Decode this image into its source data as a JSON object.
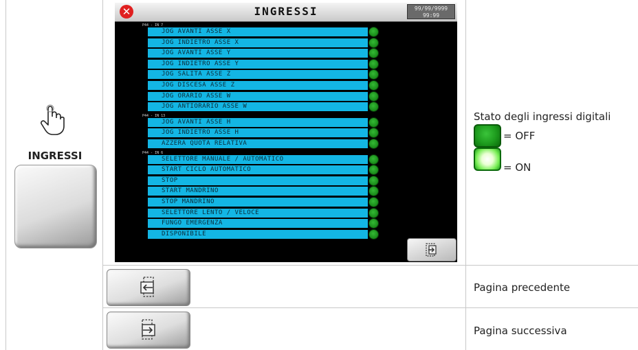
{
  "left_panel": {
    "button_caption": "INGRESSI"
  },
  "screen": {
    "title": "INGRESSI",
    "date": "99/99/9999",
    "time": "99:99",
    "groups": [
      {
        "label": "P44 - IN 7",
        "items": [
          "JOG AVANTI ASSE X",
          "JOG INDIETRO ASSE X",
          "JOG AVANTI ASSE Y",
          "JOG INDIETRO ASSE Y",
          "JOG SALITA ASSE Z",
          "JOG DISCESA ASSE Z",
          "JOG ORARIO ASSE W",
          "JOG ANTIORARIO ASSE W"
        ]
      },
      {
        "label": "P44 - IN 13",
        "items": [
          "JOG AVANTI ASSE H",
          "JOG INDIETRO ASSE H",
          "AZZERA QUOTA RELATIVA"
        ]
      },
      {
        "label": "P44 - IN 6",
        "items": [
          "SELETTORE MANUALE / AUTOMATICO",
          "START CICLO AUTOMATICO",
          "STOP",
          "START MANDRINO",
          "STOP MANDRINO",
          "SELETTORE LENTO / VELOCE",
          "FUNGO EMERGENZA",
          "DISPONIBILE"
        ]
      }
    ]
  },
  "descriptions": {
    "status_title": "Stato degli ingressi digitali",
    "off_label": "= OFF",
    "on_label": "= ON",
    "prev_page": "Pagina precedente",
    "next_page": "Pagina successiva"
  },
  "colors": {
    "item_bg": "#13b6e4",
    "led_off": "#1d9b1d",
    "led_on": "#eaffd4",
    "close": "#e02020"
  }
}
